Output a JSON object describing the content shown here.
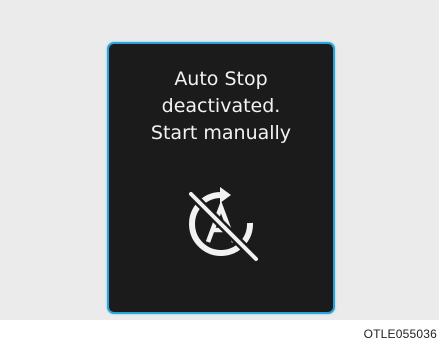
{
  "display": {
    "message_lines": [
      "Auto Stop",
      "deactivated.",
      "Start manually"
    ],
    "icon": "auto-stop-off-icon",
    "border_color": "#2aa3d8",
    "background_color": "#1b1b1b",
    "text_color": "#f2f2f2"
  },
  "figure_code": "OTLE055036"
}
